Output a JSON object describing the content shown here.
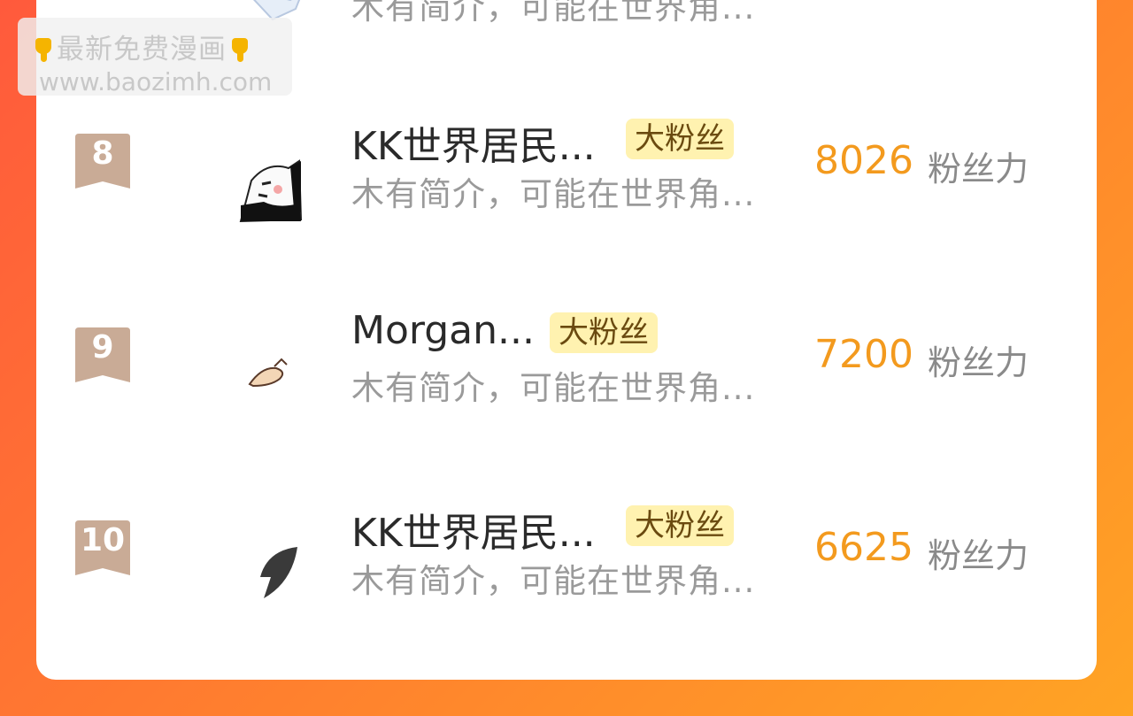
{
  "watermark": {
    "line1": "最新免费漫画",
    "line2": "www.baozimh.com"
  },
  "top_row_partial": {
    "desc": "木有简介，可能在世界角..."
  },
  "rows": [
    {
      "rank": "8",
      "name": "KK世界居民...",
      "tag": "大粉丝",
      "desc": "木有简介，可能在世界角...",
      "score": "8026",
      "unit": "粉丝力"
    },
    {
      "rank": "9",
      "name": "Morgan...",
      "tag": "大粉丝",
      "desc": "木有简介，可能在世界角...",
      "score": "7200",
      "unit": "粉丝力"
    },
    {
      "rank": "10",
      "name": "KK世界居民...",
      "tag": "大粉丝",
      "desc": "木有简介，可能在世界角...",
      "score": "6625",
      "unit": "粉丝力"
    }
  ],
  "colors": {
    "background_start": "#ff5a3c",
    "background_end": "#ffa424",
    "score": "#f39a1e",
    "tag_bg": "#fff2b0",
    "badge": "#c9ab96"
  }
}
